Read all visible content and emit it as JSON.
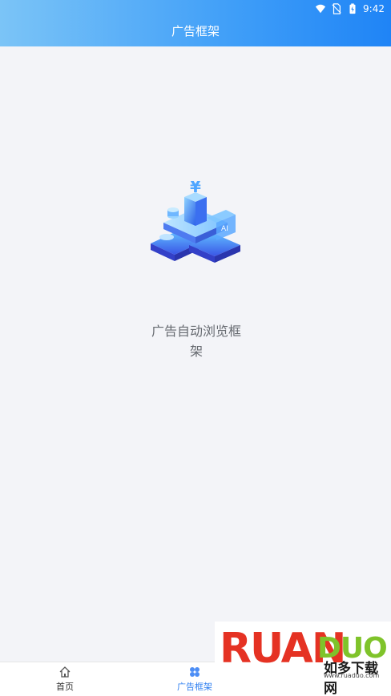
{
  "status_bar": {
    "time": "9:42",
    "icons": [
      "wifi-icon",
      "no-sim-icon",
      "battery-icon"
    ]
  },
  "header": {
    "title": "广告框架"
  },
  "main": {
    "illustration": "finance-ai-isometric-illustration",
    "caption": "广告自动浏览框架"
  },
  "bottom_nav": {
    "items": [
      {
        "label": "首页",
        "icon": "home-icon",
        "active": false
      },
      {
        "label": "广告框架",
        "icon": "apps-icon",
        "active": true
      }
    ]
  },
  "watermark": {
    "brand": "RUAN",
    "brand2": "DUO",
    "cn": "如多下载网",
    "url": "www.ruaduo.com"
  },
  "colors": {
    "header_gradient_start": "#7bc4f7",
    "header_gradient_end": "#1f84f6",
    "active_nav": "#2f7ff0",
    "background": "#f3f4f8"
  }
}
